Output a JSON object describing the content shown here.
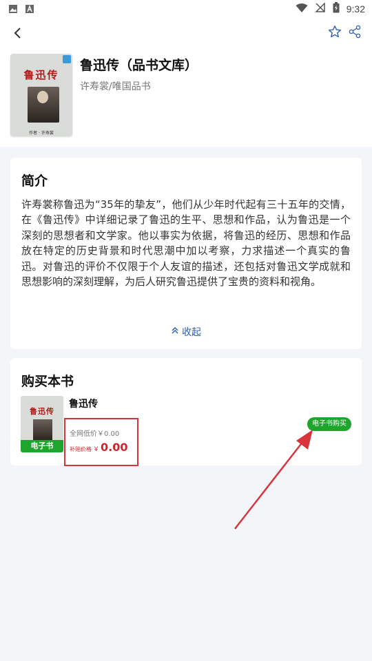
{
  "status_bar": {
    "time": "9:32",
    "icons": [
      "image-icon",
      "a-icon",
      "wifi-icon",
      "no-signal-icon",
      "battery-icon"
    ]
  },
  "toolbar": {
    "back_icon": "back-arrow-icon",
    "favorite_icon": "star-icon",
    "share_icon": "share-icon"
  },
  "book": {
    "title": "鲁迅传（品书文库）",
    "subtitle": "许寿裳/唯国品书",
    "cover_title": "鲁迅传",
    "cover_author": "作者 · 许寿裳"
  },
  "intro": {
    "heading": "简介",
    "text": "许寿裳称鲁迅为“35年的挚友”，他们从少年时代起有三十五年的交情，在《鲁迅传》中详细记录了鲁迅的生平、思想和作品，认为鲁迅是一个深刻的思想者和文学家。他以事实为依据，将鲁迅的经历、思想和作品放在特定的历史背景和时代思潮中加以考察，力求描述一个真实的鲁迅。对鲁迅的评价不仅限于个人友谊的描述，还包括对鲁迅文学成就和思想影响的深刻理解，为后人研究鲁迅提供了宝贵的资料和视角。",
    "collapse_label": "收起"
  },
  "purchase": {
    "heading": "购买本书",
    "item": {
      "title": "鲁迅传",
      "cover_title": "鲁迅传",
      "tag": "电子书",
      "market_price_line": "全网低价￥0.00",
      "subsidy_label": "补贴价格",
      "currency": "￥",
      "subsidy_value": "0.00",
      "buy_button": "电子书购买"
    }
  },
  "colors": {
    "accent_green": "#1ea52c",
    "price_red": "#d0232d",
    "link_blue": "#2b5eab",
    "annotation_red": "#d9333b"
  }
}
